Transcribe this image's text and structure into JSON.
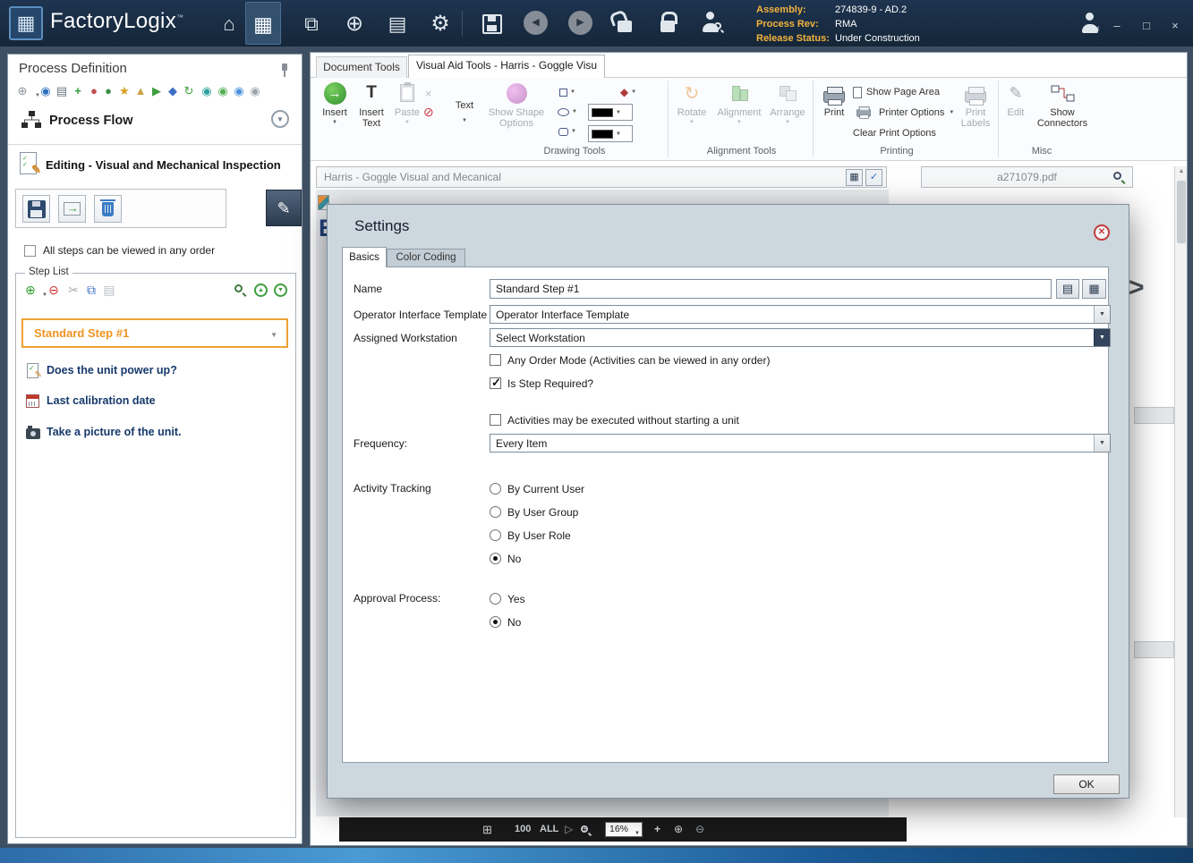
{
  "colors": {
    "titlebar_navy": "#16283e",
    "accent_orange": "#f2b33d",
    "step_selected_orange": "#f0a232",
    "step_text_navy": "#16396b",
    "dialog_bg": "#cdd7de"
  },
  "icon_glyphs": {
    "home": "⌂",
    "grid": "▦",
    "gear": "⚙",
    "dropdown": "▼",
    "check": "✓",
    "close": "×"
  },
  "titlebar": {
    "app_name": "FactoryLogix",
    "trademark": "™",
    "info": [
      {
        "label": "Assembly:",
        "value": "274839-9 - AD.2"
      },
      {
        "label": "Process Rev:",
        "value": "RMA"
      },
      {
        "label": "Release Status:",
        "value": "Under Construction"
      }
    ],
    "window": {
      "minimize": "–",
      "maximize": "□",
      "close": "×"
    }
  },
  "sidebar": {
    "title": "Process Definition",
    "process_flow": "Process Flow",
    "editing_title": "Editing - Visual and Mechanical Inspection",
    "order_checkbox": "All steps can be viewed in any order",
    "order_checkbox_checked": false,
    "step_list_title": "Step List",
    "steps": [
      "Standard Step #1",
      "Does the unit power up?",
      "Last calibration date",
      "Take a picture of the unit."
    ],
    "selected_step": "Standard Step #1"
  },
  "ribbon": {
    "tab_document": "Document Tools",
    "tab_visual": "Visual Aid Tools - Harris - Goggle Visu",
    "insert": "Insert",
    "insert_text": "Insert Text",
    "paste": "Paste",
    "text": "Text",
    "show_shape": "Show Shape Options",
    "drawing_group": "Drawing Tools",
    "rotate": "Rotate",
    "alignment": "Alignment",
    "arrange": "Arrange",
    "alignment_group": "Alignment Tools",
    "print": "Print",
    "show_page_area": "Show Page Area",
    "printer_options": "Printer Options",
    "clear_print_options": "Clear Print Options",
    "print_labels": "Print Labels",
    "printing_group": "Printing",
    "edit": "Edit",
    "show_connectors": "Show Connectors",
    "misc_group": "Misc"
  },
  "document": {
    "title": "Harris - Goggle Visual and Mecanical",
    "pdf_name": "a271079.pdf",
    "canvas_letter": "E"
  },
  "statusbar": {
    "count": "100",
    "all": "ALL",
    "zoom": "16%"
  },
  "dialog": {
    "title": "Settings",
    "tab_basics": "Basics",
    "tab_color_coding": "Color Coding",
    "name_label": "Name",
    "name_value": "Standard Step #1",
    "template_label": "Operator Interface Template",
    "template_value": "Operator Interface Template",
    "workstation_label": "Assigned Workstation",
    "workstation_value": "Select Workstation",
    "any_order_label": "Any Order Mode (Activities can be viewed in any order)",
    "any_order_checked": false,
    "required_label": "Is Step Required?",
    "required_checked": true,
    "without_unit_label": "Activities may be executed without starting a unit",
    "without_unit_checked": false,
    "frequency_label": "Frequency:",
    "frequency_value": "Every Item",
    "tracking_label": "Activity Tracking",
    "tracking_options": [
      "By Current User",
      "By User Group",
      "By User Role",
      "No"
    ],
    "tracking_selected": "No",
    "approval_label": "Approval Process:",
    "approval_options": [
      "Yes",
      "No"
    ],
    "approval_selected": "No",
    "ok_label": "OK"
  }
}
